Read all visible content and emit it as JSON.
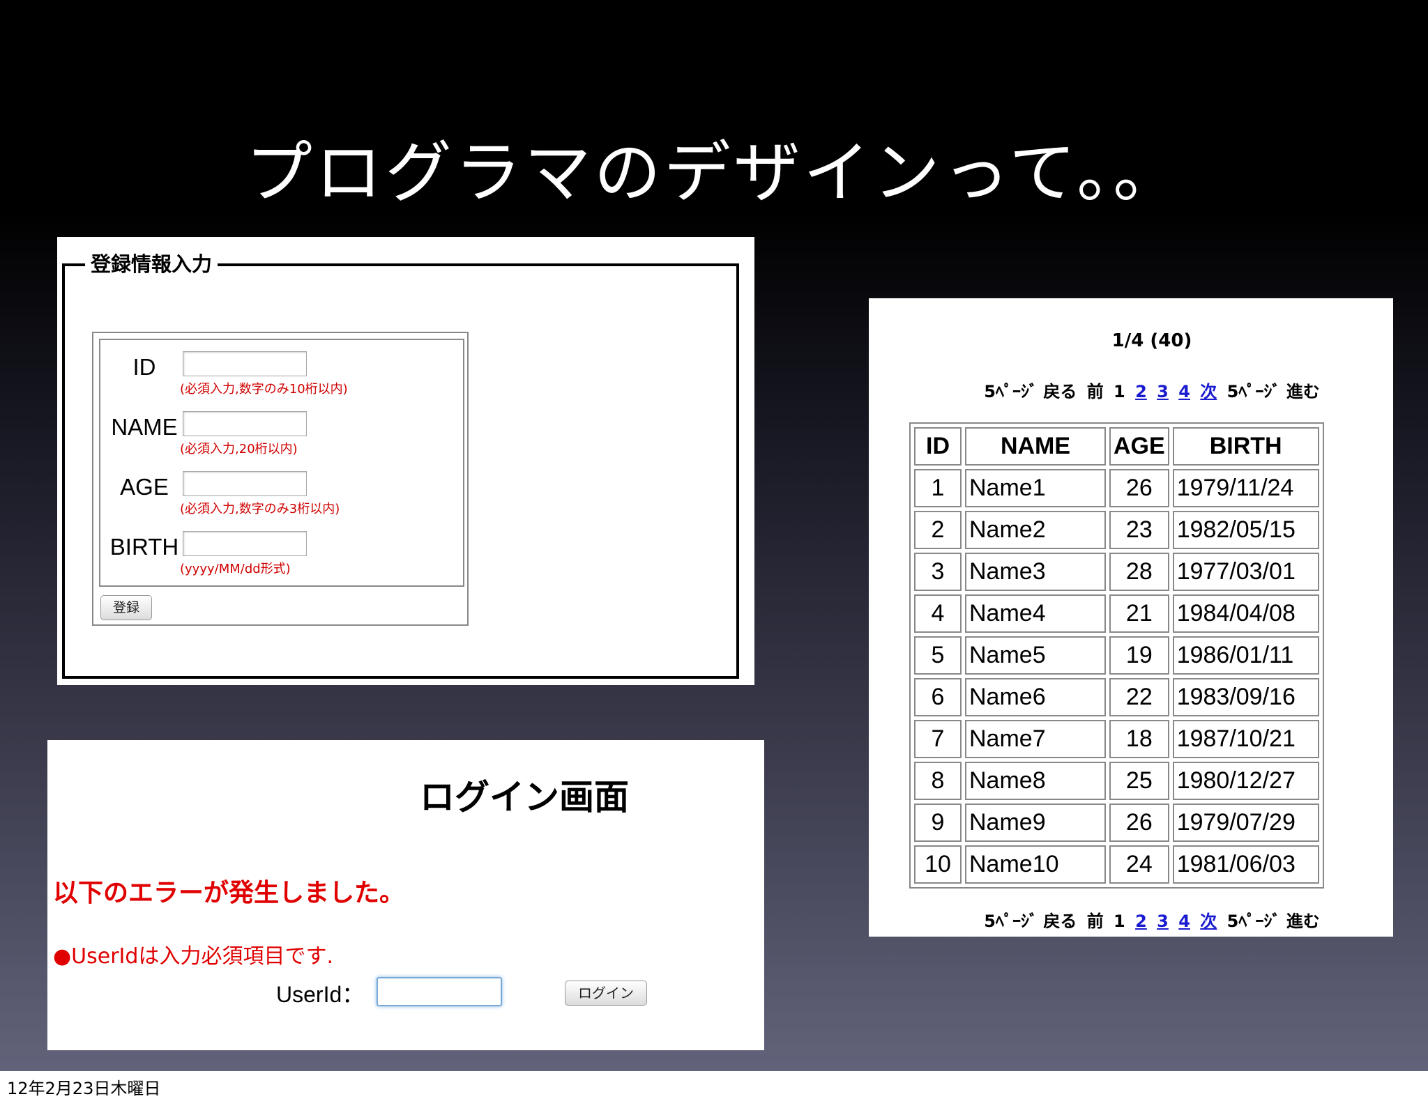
{
  "slide": {
    "title": "プログラマのデザインって。。",
    "footer_date": "12年2月23日木曜日"
  },
  "registration": {
    "legend": "登録情報入力",
    "fields": [
      {
        "label": "ID",
        "hint": "(必須入力,数字のみ10桁以内)"
      },
      {
        "label": "NAME",
        "hint": "(必須入力,20桁以内)"
      },
      {
        "label": "AGE",
        "hint": "(必須入力,数字のみ3桁以内)"
      },
      {
        "label": "BIRTH",
        "hint": "(yyyy/MM/dd形式)"
      }
    ],
    "submit_label": "登録"
  },
  "login": {
    "title": "ログイン画面",
    "error_heading": "以下のエラーが発生しました。",
    "error_message": "●UserIdは入力必須項目です.",
    "userid_label": "UserId：",
    "button_label": "ログイン"
  },
  "list": {
    "summary": "1/4 (40)",
    "pager": {
      "prev5": "5ﾍﾟｰｼﾞ 戻る",
      "prev": "前",
      "pages": [
        "1",
        "2",
        "3",
        "4"
      ],
      "next": "次",
      "next5": "5ﾍﾟｰｼﾞ 進む"
    },
    "columns": [
      "ID",
      "NAME",
      "AGE",
      "BIRTH"
    ],
    "rows": [
      [
        "1",
        "Name1",
        "26",
        "1979/11/24"
      ],
      [
        "2",
        "Name2",
        "23",
        "1982/05/15"
      ],
      [
        "3",
        "Name3",
        "28",
        "1977/03/01"
      ],
      [
        "4",
        "Name4",
        "21",
        "1984/04/08"
      ],
      [
        "5",
        "Name5",
        "19",
        "1986/01/11"
      ],
      [
        "6",
        "Name6",
        "22",
        "1983/09/16"
      ],
      [
        "7",
        "Name7",
        "18",
        "1987/10/21"
      ],
      [
        "8",
        "Name8",
        "25",
        "1980/12/27"
      ],
      [
        "9",
        "Name9",
        "26",
        "1979/07/29"
      ],
      [
        "10",
        "Name10",
        "24",
        "1981/06/03"
      ]
    ]
  }
}
